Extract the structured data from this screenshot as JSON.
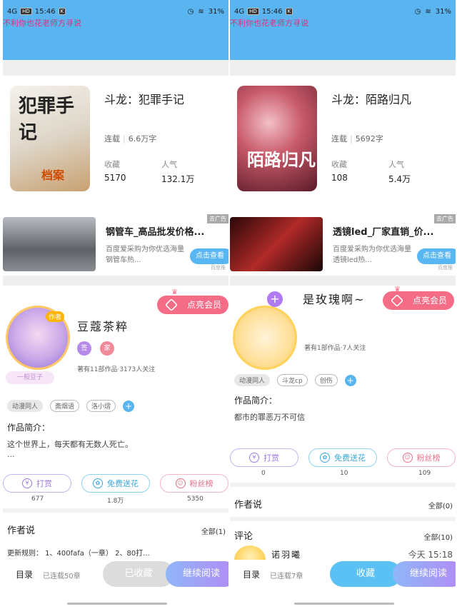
{
  "left": {
    "status": {
      "network": "4G",
      "hd": "HD",
      "time": "15:46",
      "app_icon": "K",
      "battery": "31%"
    },
    "marquee": "不利你也花老师方寻说",
    "book": {
      "title": "斗龙：犯罪手记",
      "status": "连载",
      "words": "6.6万字",
      "collect_label": "收藏",
      "collect_value": "5170",
      "popularity_label": "人气",
      "popularity_value": "132.1万",
      "cover_text": "犯罪手记",
      "cover_sub": "档案"
    },
    "ad": {
      "title": "钢管车_高品批发价格...",
      "desc": "百度爱采购为你优选海量钢管车热...",
      "button": "点击查看",
      "tag": "去广告",
      "source": "百度推"
    },
    "author": {
      "name": "豆蔻茶粹",
      "avatar_tag": "作者",
      "badge": "一般豆子",
      "tag1": "签",
      "tag2": "家",
      "info": "著有11部作品·3173人关注",
      "vip": "点亮会员",
      "chips": [
        "动漫同人",
        "斋烟语",
        "洛小熠"
      ],
      "intro_label": "作品简介：",
      "intro_text": "这个世界上，每天都有无数人死亡。",
      "intro_more": "...",
      "actions": [
        "打赏",
        "免费送花",
        "粉丝榜"
      ],
      "counts": [
        "677",
        "1.8万",
        "5350"
      ],
      "says_label": "作者说",
      "says_more": "全部(1)",
      "rule_text": "更新规则：  1、400fafa（一章）  2、80打..."
    },
    "bottom": {
      "dir": "目录",
      "updated": "已连载50章",
      "shelf": "已收藏",
      "read": "继续阅读"
    }
  },
  "right": {
    "status": {
      "network": "4G",
      "hd": "HD",
      "time": "15:46",
      "app_icon": "K",
      "battery": "31%"
    },
    "marquee": "不利你也花老师方寻说",
    "book": {
      "title": "斗龙：陌路归凡",
      "status": "连载",
      "words": "5692字",
      "collect_label": "收藏",
      "collect_value": "108",
      "popularity_label": "人气",
      "popularity_value": "5.4万",
      "cover_text": "陌路归凡"
    },
    "ad": {
      "title": "透镜led_厂家直销_价...",
      "desc": "百度爱采购为你优选海量透镜led热...",
      "button": "点击查看",
      "tag": "去广告",
      "source": "百度推"
    },
    "author": {
      "name": "是玫瑰啊~",
      "badge_plus": "+",
      "info": "著有1部作品·7人关注",
      "vip": "点亮会员",
      "chips": [
        "动漫同人",
        "斗龙cp",
        "创伤"
      ],
      "intro_label": "作品简介：",
      "intro_text": "都市的罪恶万不可信",
      "actions": [
        "打赏",
        "免费送花",
        "粉丝榜"
      ],
      "counts": [
        "0",
        "10",
        "109"
      ],
      "says_label": "作者说",
      "says_more": "全部(0)",
      "comment_label": "评论",
      "comment_more": "全部(10)",
      "commenter": "诺羽曦",
      "comment_time": "今天 15:18"
    },
    "bottom": {
      "dir": "目录",
      "updated": "已连载7章",
      "shelf": "收藏",
      "read": "继续阅读"
    }
  },
  "colors": {
    "topbar": "#5ab4f0",
    "vip": "#f56c86",
    "read_btn": "#b38af5",
    "shelf_btn_left": "#dcdcdc",
    "shelf_btn_right": "#5bc0f4"
  }
}
